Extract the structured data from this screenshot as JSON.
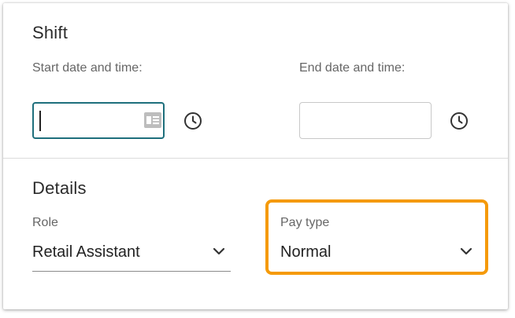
{
  "shift": {
    "title": "Shift",
    "start_label": "Start date and time:",
    "end_label": "End date and time:",
    "start_value": "",
    "end_value": ""
  },
  "details": {
    "title": "Details",
    "role_label": "Role",
    "role_value": "Retail Assistant",
    "pay_type_label": "Pay type",
    "pay_type_value": "Normal"
  },
  "icons": {
    "date_picker": "calendar-card-icon",
    "time_picker": "clock-icon",
    "dropdown": "chevron-down-icon"
  },
  "colors": {
    "focus_border": "#1e6f7c",
    "highlight": "#f59a0a"
  }
}
